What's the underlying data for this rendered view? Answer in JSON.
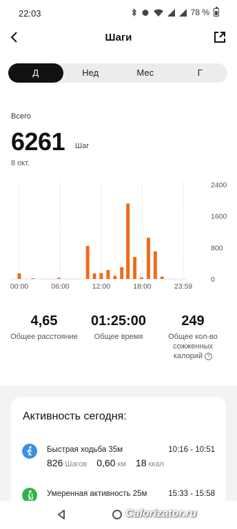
{
  "status_bar": {
    "time": "22:03",
    "battery": "78 %"
  },
  "header": {
    "title": "Шаги"
  },
  "tabs": [
    {
      "label": "Д",
      "active": true
    },
    {
      "label": "Нед",
      "active": false
    },
    {
      "label": "Мес",
      "active": false
    },
    {
      "label": "Г",
      "active": false
    }
  ],
  "summary": {
    "total_label": "Всего",
    "total_value": "6261",
    "unit": "Шаг",
    "date": "8 окт."
  },
  "chart_data": {
    "type": "bar",
    "bar_color": "#f26a1b",
    "x_tick_labels": [
      "00:00",
      "06:00",
      "12:00",
      "18:00",
      "23:59"
    ],
    "x_tick_hours": [
      0,
      6,
      12,
      18,
      24
    ],
    "y_tick_labels": [
      "2400",
      "1600",
      "800",
      "0"
    ],
    "y_tick_values": [
      2400,
      1600,
      800,
      0
    ],
    "ylim": [
      0,
      2400
    ],
    "x_unit": "hour",
    "bars": [
      {
        "hour": 0.0,
        "value": 140
      },
      {
        "hour": 2.0,
        "value": 20
      },
      {
        "hour": 5.8,
        "value": 30
      },
      {
        "hour": 10.0,
        "value": 840
      },
      {
        "hour": 11.0,
        "value": 140
      },
      {
        "hour": 12.0,
        "value": 150
      },
      {
        "hour": 13.0,
        "value": 230
      },
      {
        "hour": 14.0,
        "value": 80
      },
      {
        "hour": 15.0,
        "value": 300
      },
      {
        "hour": 15.9,
        "value": 1920
      },
      {
        "hour": 16.9,
        "value": 560
      },
      {
        "hour": 17.9,
        "value": 40
      },
      {
        "hour": 18.9,
        "value": 1050
      },
      {
        "hour": 19.9,
        "value": 700
      },
      {
        "hour": 20.9,
        "value": 60
      }
    ]
  },
  "metrics": [
    {
      "value": "4,65",
      "label": "Общее расстояние"
    },
    {
      "value": "01:25:00",
      "label": "Общее время"
    },
    {
      "value": "249",
      "label_line1": "Общее кол-во",
      "label_line2": "сожженных",
      "label_line3": "калорий"
    }
  ],
  "activity": {
    "title": "Активность сегодня",
    "items": [
      {
        "name": "Быстрая ходьба 35м",
        "time": "10:16 - 10:51",
        "icon_color": "#3b8fe6",
        "steps": "826",
        "steps_unit": "Шагов",
        "distance": "0,60",
        "distance_unit": "км",
        "calories": "18",
        "calories_unit": "ккал"
      },
      {
        "name": "Умеренная активность 25м",
        "time": "15:33 - 15:58",
        "icon_color": "#2fb34a"
      }
    ]
  },
  "watermark": "Calorizator.ru"
}
